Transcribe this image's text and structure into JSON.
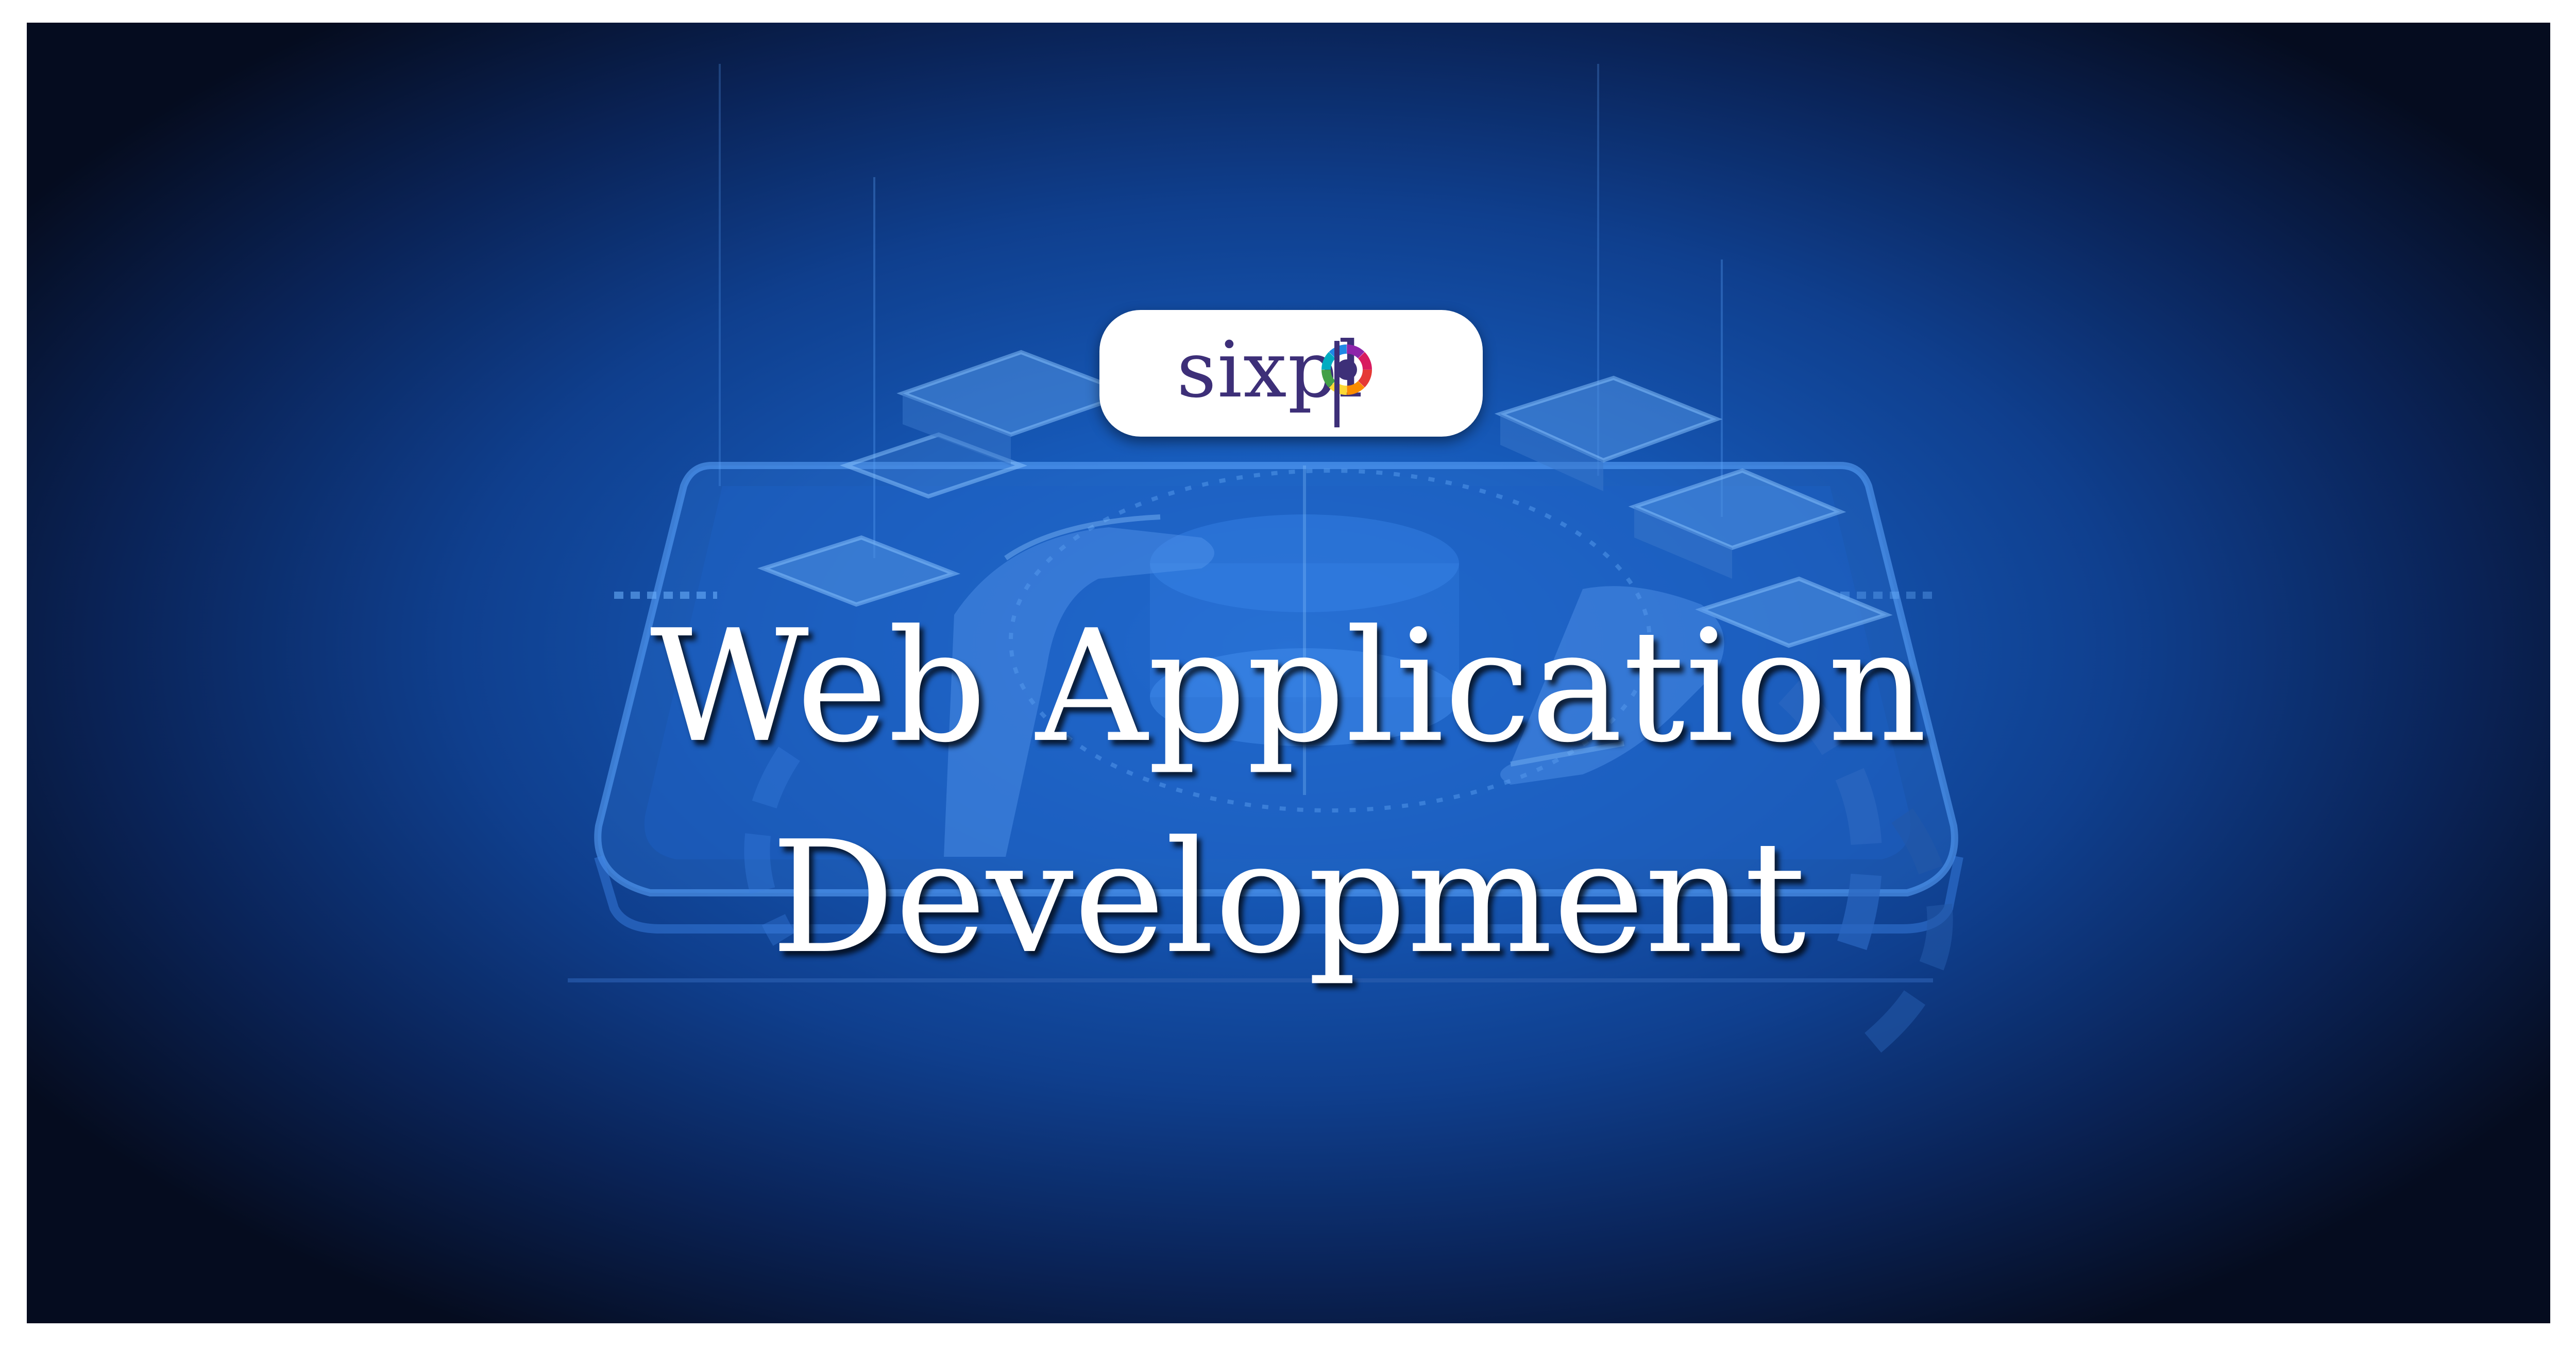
{
  "brand": {
    "name": "sixpl",
    "logo": "sixpl-logo"
  },
  "headline": {
    "line1": "Web Application",
    "line2": "Development"
  },
  "colors": {
    "frame": "#ffffff",
    "background_center": "#1f6fd6",
    "background_edge": "#050c1f",
    "headline_text": "#ffffff",
    "logo_text": "#3d2f78",
    "pill": "#ffffff"
  }
}
